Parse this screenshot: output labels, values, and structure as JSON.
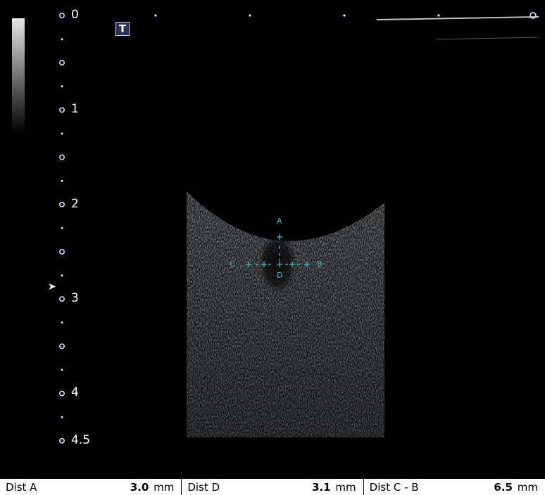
{
  "depth_scale": {
    "labels": [
      "0",
      "1",
      "2",
      "3",
      "4",
      "4.5"
    ]
  },
  "toolbar": {
    "t_button_label": "T"
  },
  "calipers": {
    "labels": [
      "A",
      "D",
      "C",
      "B"
    ],
    "color": "#29c5cf"
  },
  "measurements": [
    {
      "label": "Dist  A",
      "value": "3.0",
      "unit": "mm"
    },
    {
      "label": "Dist  D",
      "value": "3.1",
      "unit": "mm"
    },
    {
      "label": "Dist  C - B",
      "value": "6.5",
      "unit": "mm"
    }
  ]
}
